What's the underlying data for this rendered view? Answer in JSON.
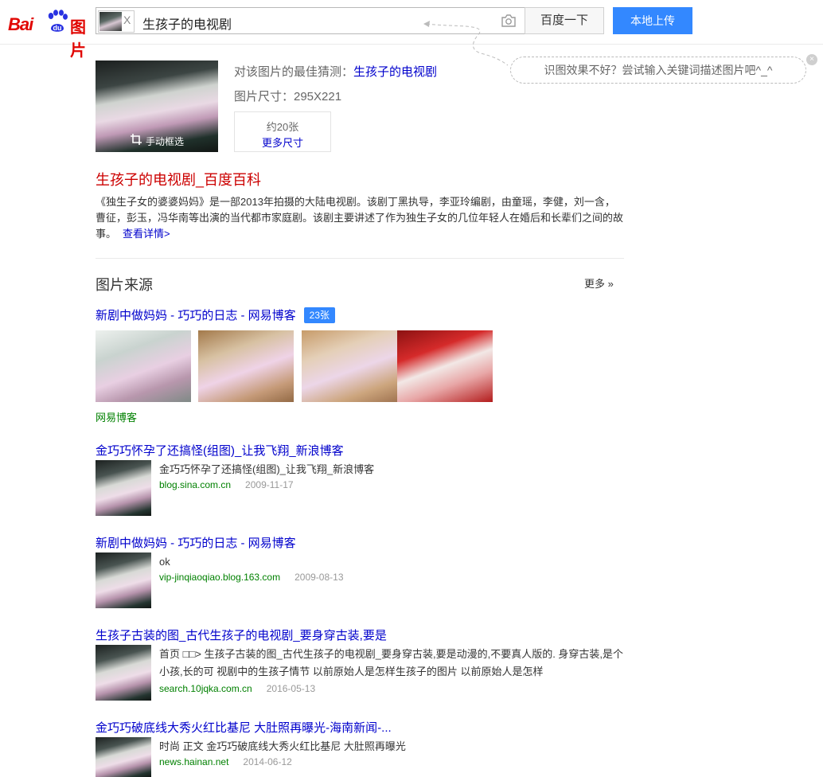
{
  "header": {
    "logo_bai": "Bai",
    "logo_du": "du",
    "logo_tupian": "图片",
    "clear_label": "X",
    "query": "生孩子的电视剧",
    "search_button": "百度一下",
    "upload_button": "本地上传"
  },
  "tip": {
    "text": "识图效果不好？尝试输入关键词描述图片吧^_^",
    "close": "×"
  },
  "main": {
    "crop_label": "手动框选",
    "guess_prefix": "对该图片的最佳猜测：",
    "guess_value": "生孩子的电视剧",
    "size_text": "图片尺寸：295X221",
    "count_text": "约20张",
    "more_sizes": "更多尺寸"
  },
  "baike": {
    "title": "生孩子的电视剧_百度百科",
    "desc": "《独生子女的婆婆妈妈》是一部2013年拍摄的大陆电视剧。该剧丁黑执导，李亚玲编剧，由童瑶，李健，刘一含，曹征，彭玉，冯华南等出演的当代都市家庭剧。该剧主要讲述了作为独生子女的几位年轻人在婚后和长辈们之间的故事。",
    "detail_link": "查看详情>"
  },
  "sources": {
    "title": "图片来源",
    "more": "更多 »"
  },
  "results": [
    {
      "title": "新剧中做妈妈 - 巧巧的日志 - 网易博客",
      "badge": "23张",
      "source": "网易博客"
    },
    {
      "title": "金巧巧怀孕了还搞怪(组图)_让我飞翔_新浪博客",
      "snippet": "金巧巧怀孕了还搞怪(组图)_让我飞翔_新浪博客",
      "url": "blog.sina.com.cn",
      "date": "2009-11-17"
    },
    {
      "title": "新剧中做妈妈 - 巧巧的日志 - 网易博客",
      "snippet": "ok",
      "url": "vip-jinqiaoqiao.blog.163.com",
      "date": "2009-08-13"
    },
    {
      "title": "生孩子古装的图_古代生孩子的电视剧_要身穿古装,要是",
      "snippet": "首页 □□> 生孩子古装的图_古代生孩子的电视剧_要身穿古装,要是动漫的,不要真人版的. 身穿古装,是个小孩,长的可 视剧中的生孩子情节 以前原始人是怎样生孩子的图片 以前原始人是怎样",
      "url": "search.10jqka.com.cn",
      "date": "2016-05-13"
    },
    {
      "title": "金巧巧破底线大秀火红比基尼 大肚照再曝光-海南新闻-...",
      "snippet": "时尚 正文 金巧巧破底线大秀火红比基尼 大肚照再曝光",
      "url": "news.hainan.net",
      "date": "2014-06-12"
    }
  ],
  "colors": {
    "brand_red": "#e10602",
    "link_blue": "#0000cc",
    "accent_blue": "#3388ff",
    "url_green": "#008000"
  }
}
